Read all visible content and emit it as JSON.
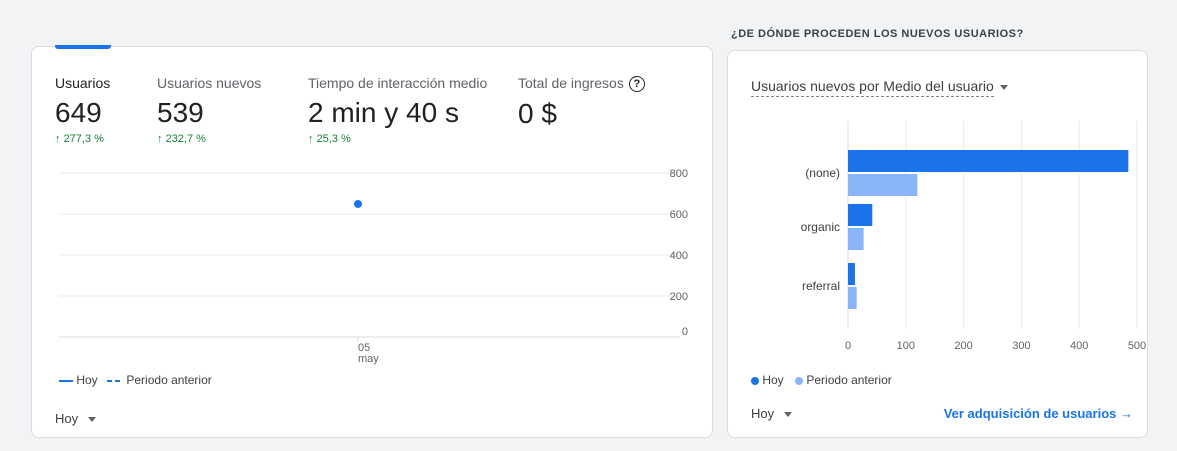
{
  "left_card": {
    "metrics": [
      {
        "label": "Usuarios",
        "value": "649",
        "change": "277,3 %"
      },
      {
        "label": "Usuarios nuevos",
        "value": "539",
        "change": "232,7 %"
      },
      {
        "label": "Tiempo de interacción medio",
        "value": "2 min y 40 s",
        "change": "25,3 %"
      },
      {
        "label": "Total de ingresos",
        "value": "0 $",
        "change": ""
      }
    ],
    "legend": {
      "current": "Hoy",
      "previous": "Periodo anterior"
    },
    "date_range": "Hoy"
  },
  "right_card": {
    "section_title": "¿DE DÓNDE PROCEDEN LOS NUEVOS USUARIOS?",
    "dropdown_label": "Usuarios nuevos por Medio del usuario",
    "legend": {
      "current": "Hoy",
      "previous": "Periodo anterior"
    },
    "date_range": "Hoy",
    "link_label": "Ver adquisición de usuarios"
  },
  "colors": {
    "current": "#1a73e8",
    "previous": "#8ab4f8",
    "positive": "#188038"
  },
  "chart_data": [
    {
      "type": "line",
      "x_ticks": [
        {
          "day": "05",
          "month": "may"
        }
      ],
      "y_ticks": [
        "800",
        "600",
        "400",
        "200",
        "0"
      ],
      "ylim": [
        0,
        800
      ],
      "series": [
        {
          "name": "Hoy",
          "points": [
            {
              "x": "05 may",
              "y": 649
            }
          ]
        }
      ],
      "grid": true
    },
    {
      "type": "bar",
      "orientation": "horizontal",
      "categories": [
        "(none)",
        "organic",
        "referral"
      ],
      "series": [
        {
          "name": "Hoy",
          "values": [
            485,
            42,
            12
          ]
        },
        {
          "name": "Periodo anterior",
          "values": [
            120,
            27,
            15
          ]
        }
      ],
      "x_ticks": [
        "0",
        "100",
        "200",
        "300",
        "400",
        "500"
      ],
      "xlim": [
        0,
        500
      ],
      "grid": true,
      "legend_position": "bottom-left"
    }
  ]
}
